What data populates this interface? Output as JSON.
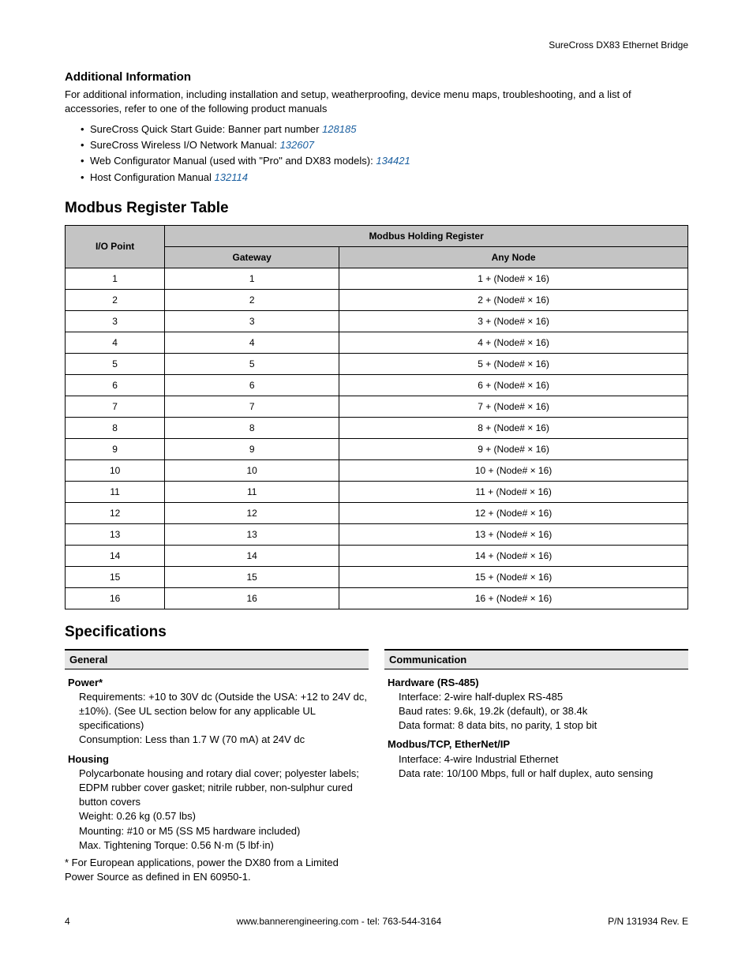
{
  "header": {
    "product": "SureCross DX83 Ethernet Bridge"
  },
  "section_additional": {
    "title": "Additional Information",
    "para": "For additional information, including installation and setup, weatherproofing, device menu maps, troubleshooting, and a list of accessories, refer to one of the following product manuals",
    "items": [
      {
        "text": "SureCross Quick Start Guide: Banner part number ",
        "link": "128185"
      },
      {
        "text": "SureCross Wireless I/O Network Manual: ",
        "link": "132607"
      },
      {
        "text": "Web Configurator Manual (used with \"Pro\" and DX83 models): ",
        "link": "134421"
      },
      {
        "text": "Host Configuration Manual ",
        "link": "132114"
      }
    ]
  },
  "section_modbus": {
    "title": "Modbus Register Table",
    "headers": {
      "col1": "I/O Point",
      "col2": "Modbus Holding Register",
      "sub1": "Gateway",
      "sub2": "Any Node"
    },
    "rows": [
      {
        "io": "1",
        "gw": "1",
        "node": "1 + (Node# × 16)"
      },
      {
        "io": "2",
        "gw": "2",
        "node": "2 + (Node# × 16)"
      },
      {
        "io": "3",
        "gw": "3",
        "node": "3 + (Node# × 16)"
      },
      {
        "io": "4",
        "gw": "4",
        "node": "4 + (Node# × 16)"
      },
      {
        "io": "5",
        "gw": "5",
        "node": "5 + (Node# × 16)"
      },
      {
        "io": "6",
        "gw": "6",
        "node": "6 + (Node# × 16)"
      },
      {
        "io": "7",
        "gw": "7",
        "node": "7 + (Node# × 16)"
      },
      {
        "io": "8",
        "gw": "8",
        "node": "8 + (Node# × 16)"
      },
      {
        "io": "9",
        "gw": "9",
        "node": "9 + (Node# × 16)"
      },
      {
        "io": "10",
        "gw": "10",
        "node": "10 + (Node# × 16)"
      },
      {
        "io": "11",
        "gw": "11",
        "node": "11 + (Node# × 16)"
      },
      {
        "io": "12",
        "gw": "12",
        "node": "12 + (Node# × 16)"
      },
      {
        "io": "13",
        "gw": "13",
        "node": "13 + (Node# × 16)"
      },
      {
        "io": "14",
        "gw": "14",
        "node": "14 + (Node# × 16)"
      },
      {
        "io": "15",
        "gw": "15",
        "node": "15 + (Node# × 16)"
      },
      {
        "io": "16",
        "gw": "16",
        "node": "16 + (Node# × 16)"
      }
    ]
  },
  "section_specs": {
    "title": "Specifications",
    "general": {
      "head": "General",
      "power_title": "Power*",
      "power_req": "Requirements: +10 to 30V dc (Outside the USA: +12 to 24V dc, ±10%). (See UL section below for any applicable UL specifications)",
      "power_cons": "Consumption: Less than 1.7 W (70 mA) at 24V dc",
      "housing_title": "Housing",
      "housing_mat": "Polycarbonate housing and rotary dial cover; polyester labels; EDPM rubber cover gasket; nitrile rubber, non-sulphur cured button covers",
      "housing_weight": "Weight: 0.26 kg (0.57 lbs)",
      "housing_mount": "Mounting: #10 or M5 (SS M5 hardware included)",
      "housing_torque": "Max. Tightening Torque: 0.56 N·m (5 lbf·in)",
      "footnote": "* For European applications, power the DX80 from a Limited Power Source as defined in EN 60950-1."
    },
    "comm": {
      "head": "Communication",
      "hw_title": "Hardware (RS-485)",
      "hw_iface": "Interface: 2-wire half-duplex RS-485",
      "hw_baud": "Baud rates: 9.6k, 19.2k (default), or 38.4k",
      "hw_fmt": "Data format: 8 data bits, no parity, 1 stop bit",
      "mb_title": "Modbus/TCP, EtherNet/IP",
      "mb_iface": "Interface: 4-wire Industrial Ethernet",
      "mb_rate": "Data rate: 10/100 Mbps, full or half duplex, auto sensing"
    }
  },
  "footer": {
    "page": "4",
    "center": "www.bannerengineering.com - tel: 763-544-3164",
    "right": "P/N 131934 Rev. E"
  }
}
